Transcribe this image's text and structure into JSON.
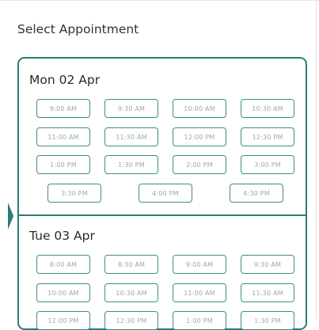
{
  "header": {
    "title": "Select Appointment"
  },
  "days": [
    {
      "label": "Mon 02 Apr",
      "slots": [
        "9:00 AM",
        "9:30 AM",
        "10:00 AM",
        "10:30 AM",
        "11:00 AM",
        "11:30 AM",
        "12:00 PM",
        "12:30 PM",
        "1:00 PM",
        "1:30 PM",
        "2:00 PM",
        "3:00 PM",
        "3:30 PM",
        "4:00 PM",
        "4:30 PM"
      ]
    },
    {
      "label": "Tue 03 Apr",
      "slots": [
        "8:00 AM",
        "8:30 AM",
        "9:00 AM",
        "9:30 AM",
        "10:00 AM",
        "10:30 AM",
        "11:00 AM",
        "11:30 AM",
        "12:00 PM",
        "12:30 PM",
        "1:00 PM",
        "1:30 PM"
      ]
    }
  ],
  "colors": {
    "accent": "#2a7c74",
    "slot_border": "#3c8f86",
    "slot_text": "#9aa9a7"
  }
}
